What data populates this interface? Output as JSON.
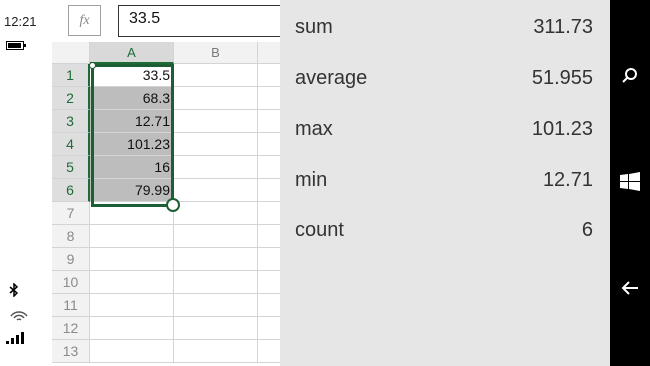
{
  "status": {
    "time": "12:21"
  },
  "formula_bar": {
    "fx_label": "fx",
    "value": "33.5"
  },
  "columns": [
    "A",
    "B"
  ],
  "rows": [
    {
      "num": "1",
      "a": "33.5",
      "b": ""
    },
    {
      "num": "2",
      "a": "68.3",
      "b": ""
    },
    {
      "num": "3",
      "a": "12.71",
      "b": ""
    },
    {
      "num": "4",
      "a": "101.23",
      "b": ""
    },
    {
      "num": "5",
      "a": "16",
      "b": ""
    },
    {
      "num": "6",
      "a": "79.99",
      "b": ""
    },
    {
      "num": "7",
      "a": "",
      "b": ""
    },
    {
      "num": "8",
      "a": "",
      "b": ""
    },
    {
      "num": "9",
      "a": "",
      "b": ""
    },
    {
      "num": "10",
      "a": "",
      "b": ""
    },
    {
      "num": "11",
      "a": "",
      "b": ""
    },
    {
      "num": "12",
      "a": "",
      "b": ""
    },
    {
      "num": "13",
      "a": "",
      "b": ""
    }
  ],
  "stats": [
    {
      "label": "sum",
      "value": "311.73"
    },
    {
      "label": "average",
      "value": "51.955"
    },
    {
      "label": "max",
      "value": "101.23"
    },
    {
      "label": "min",
      "value": "12.71"
    },
    {
      "label": "count",
      "value": "6"
    }
  ],
  "colors": {
    "accent": "#1e5e34",
    "panel": "#e6e6e6",
    "selection": "#bdbdbd"
  },
  "icons": [
    "battery-icon",
    "bluetooth-icon",
    "wifi-icon",
    "signal-icon",
    "search-icon",
    "windows-icon",
    "back-icon"
  ]
}
